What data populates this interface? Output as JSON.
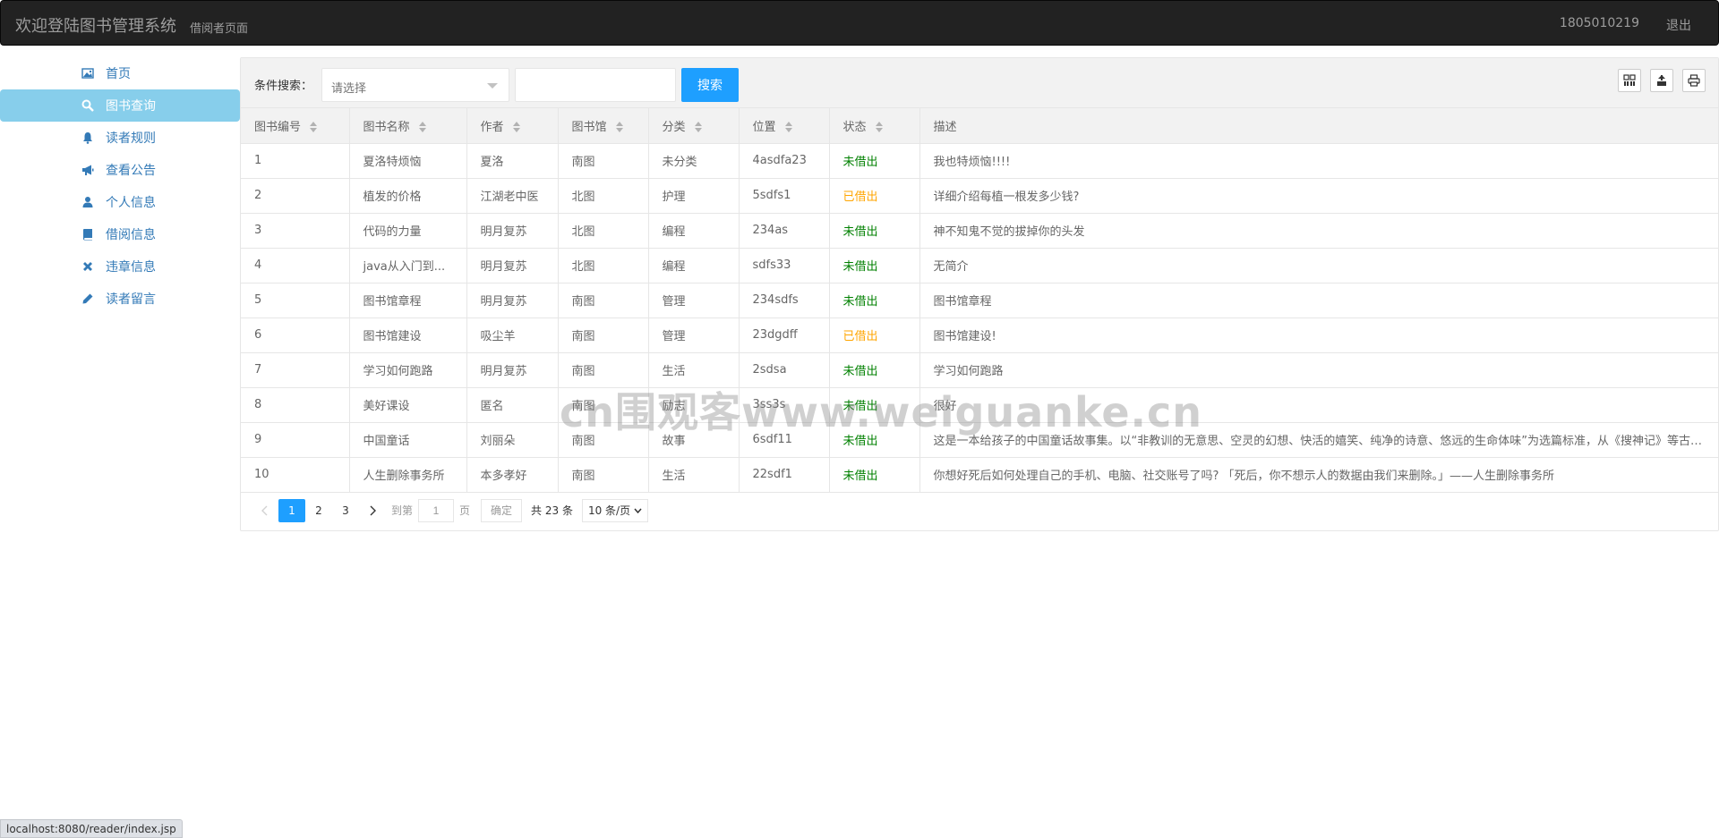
{
  "header": {
    "title": "欢迎登陆图书管理系统",
    "subtitle": "借阅者页面",
    "user": "1805010219",
    "logout": "退出"
  },
  "sidebar": {
    "items": [
      {
        "label": "首页",
        "icon": "picture-icon"
      },
      {
        "label": "图书查询",
        "icon": "search-icon",
        "active": true
      },
      {
        "label": "读者规则",
        "icon": "bell-icon"
      },
      {
        "label": "查看公告",
        "icon": "bullhorn-icon"
      },
      {
        "label": "个人信息",
        "icon": "user-icon"
      },
      {
        "label": "借阅信息",
        "icon": "book-icon"
      },
      {
        "label": "违章信息",
        "icon": "remove-icon"
      },
      {
        "label": "读者留言",
        "icon": "pencil-icon"
      }
    ]
  },
  "search": {
    "label": "条件搜索：",
    "select_placeholder": "请选择",
    "input_value": "",
    "button": "搜索"
  },
  "table": {
    "columns": [
      "图书编号",
      "图书名称",
      "作者",
      "图书馆",
      "分类",
      "位置",
      "状态",
      "描述"
    ],
    "rows": [
      [
        "1",
        "夏洛特烦恼",
        "夏洛",
        "南图",
        "未分类",
        "4asdfa23",
        "未借出",
        "我也特烦恼!!!!"
      ],
      [
        "2",
        "植发的价格",
        "江湖老中医",
        "北图",
        "护理",
        "5sdfs1",
        "已借出",
        "详细介绍每植一根发多少钱?"
      ],
      [
        "3",
        "代码的力量",
        "明月复苏",
        "北图",
        "编程",
        "234as",
        "未借出",
        "神不知鬼不觉的拔掉你的头发"
      ],
      [
        "4",
        "java从入门到...",
        "明月复苏",
        "北图",
        "编程",
        "sdfs33",
        "未借出",
        "无简介"
      ],
      [
        "5",
        "图书馆章程",
        "明月复苏",
        "南图",
        "管理",
        "234sdfs",
        "未借出",
        "图书馆章程"
      ],
      [
        "6",
        "图书馆建设",
        "吸尘羊",
        "南图",
        "管理",
        "23dgdff",
        "已借出",
        "图书馆建设!"
      ],
      [
        "7",
        "学习如何跑路",
        "明月复苏",
        "南图",
        "生活",
        "2sdsa",
        "未借出",
        "学习如何跑路"
      ],
      [
        "8",
        "美好课设",
        "匿名",
        "南图",
        "励志",
        "3ss3s",
        "未借出",
        "很好"
      ],
      [
        "9",
        "中国童话",
        "刘丽朵",
        "南图",
        "故事",
        "6sdf11",
        "未借出",
        "这是一本给孩子的中国童话故事集。以“非教训的无意思、空灵的幻想、快活的嬉笑、纯净的诗意、悠远的生命体味”为选篇标准，从《搜神记》等古籍中精选故事"
      ],
      [
        "10",
        "人生删除事务所",
        "本多孝好",
        "南图",
        "生活",
        "22sdf1",
        "未借出",
        "你想好死后如何处理自己的手机、电脑、社交账号了吗? 「死后，你不想示人的数据由我们来删除。」——人生删除事务所"
      ]
    ]
  },
  "status_colors": {
    "未借出": "#008000",
    "已借出": "#ffa500"
  },
  "pager": {
    "pages": [
      "1",
      "2",
      "3"
    ],
    "current": "1",
    "goto_label": "到第",
    "goto_value": "1",
    "page_unit": "页",
    "confirm": "确定",
    "total": "共 23 条",
    "page_size": "10 条/页"
  },
  "watermark": "cn围观客www.weiguanke.cn",
  "statusbar": "localhost:8080/reader/index.jsp"
}
